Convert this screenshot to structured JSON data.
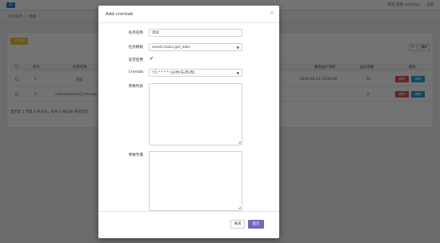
{
  "topbar": {
    "menu_icon": "☰",
    "user_label": "欢迎 游客 AutoOps",
    "logout_label": "注销"
  },
  "breadcrumb": {
    "items": [
      "计划任务",
      "周期"
    ]
  },
  "toolbar": {
    "add_label": "+ 添加",
    "refresh_icon": "↻",
    "columns_icon": "▦▾"
  },
  "table": {
    "headers": {
      "index": "序号",
      "name": "任务名称",
      "last_run": "最后运行时间",
      "run_count": "运行次数",
      "actions": "操作"
    },
    "rows": [
      {
        "index": "1",
        "name": "测试",
        "last_run": "2020-05-23 20:54:06",
        "run_count": "55",
        "delete_label": "删除",
        "edit_label": "编辑"
      },
      {
        "index": "2",
        "name": "celery.backend_cleanup",
        "last_run": "-",
        "run_count": "0",
        "delete_label": "删除",
        "edit_label": "编辑"
      }
    ],
    "pager_text": "显示第 1 到第 2 条记录，总共 2 条记录  每页显示"
  },
  "modal": {
    "title": "Add crontab",
    "close_icon": "×",
    "fields": {
      "task_name_label": "任务名称",
      "task_name_value": "测试",
      "task_template_label": "任务模板",
      "task_template_value": "assets.tasks.get_date",
      "enabled_label": "是否启用",
      "enabled_mark": "✔",
      "crontab_label": "Crontab",
      "crontab_value": "*/1 * * * * (分/时/天/月/周)",
      "params_list_label": "参数列表",
      "params_dict_label": "参数字典"
    },
    "footer": {
      "close_label": "关闭",
      "submit_label": "提交"
    }
  }
}
